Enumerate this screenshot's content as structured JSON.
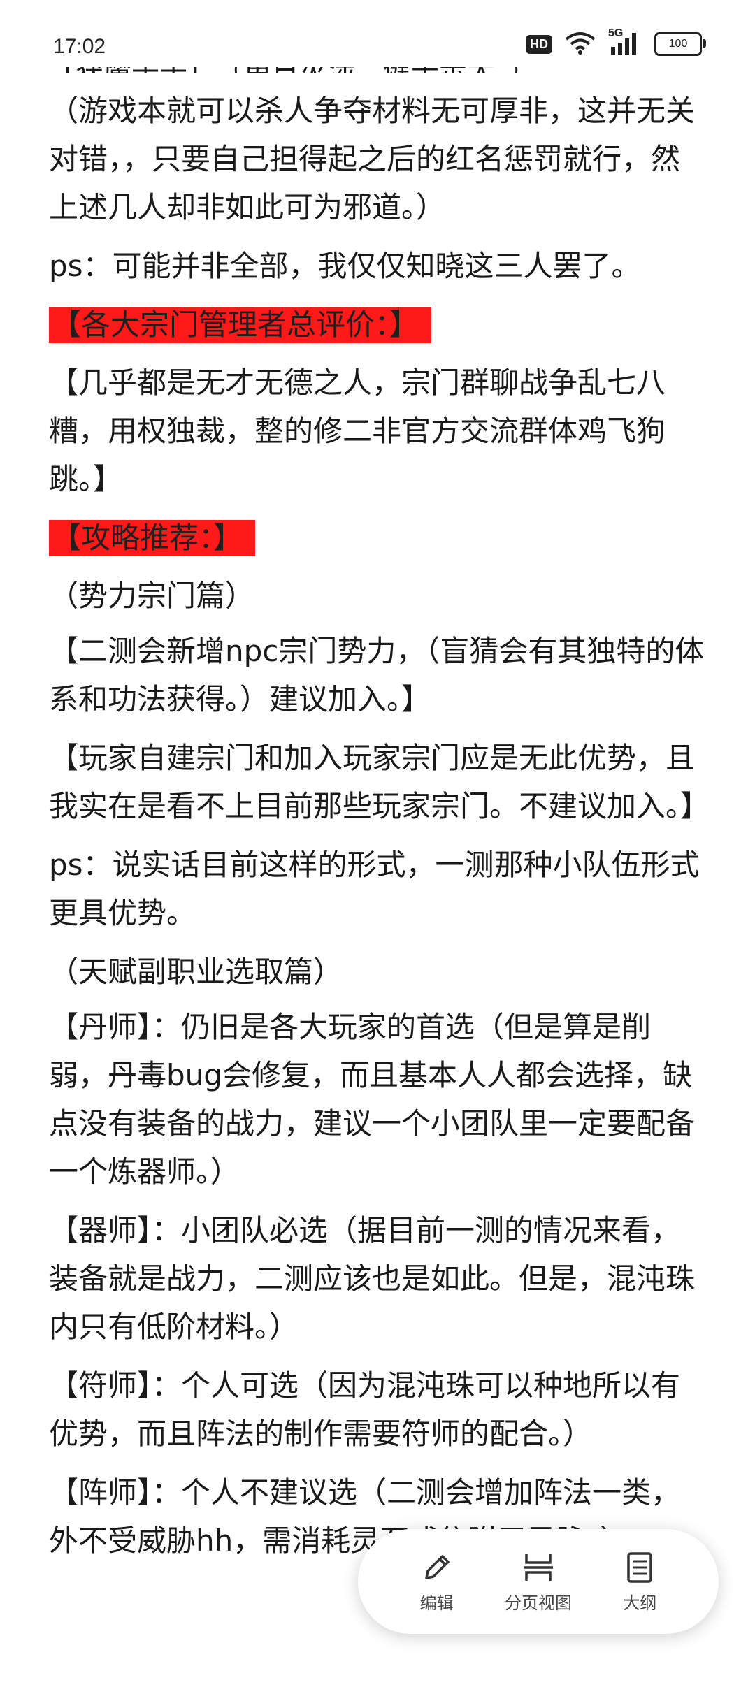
{
  "status_bar": {
    "time": "17:02",
    "hd": "HD",
    "network": "5G",
    "battery": "100"
  },
  "clipped_top_line": "【获魔子子】：（更日灭涉，健于示大。）",
  "paragraphs": [
    "（游戏本就可以杀人争夺材料无可厚非，这并无关对错，，只要自己担得起之后的红名惩罚就行，然上述几人却非如此可为邪道。）",
    "ps：可能并非全部，我仅仅知晓这三人罢了。"
  ],
  "section1": {
    "heading": "【各大宗门管理者总评价：】",
    "body": "【几乎都是无才无德之人，宗门群聊战争乱七八糟，用权独裁，整的修二非官方交流群体鸡飞狗跳。】"
  },
  "section2": {
    "heading": "【攻略推荐：】",
    "sub_forces": "（势力宗门篇）",
    "p1": "【二测会新增npc宗门势力，（盲猜会有其独特的体系和功法获得。）建议加入。】",
    "p2": "【玩家自建宗门和加入玩家宗门应是无此优势，且我实在是看不上目前那些玩家宗门。不建议加入。】",
    "p3": "ps：说实话目前这样的形式，一测那种小队伍形式更具优势。",
    "sub_talent": "（天赋副职业选取篇）",
    "p4": "【丹师】：仍旧是各大玩家的首选（但是算是削弱，丹毒bug会修复，而且基本人人都会选择，缺点没有装备的战力，建议一个小团队里一定要配备一个炼器师。）",
    "p5": "【器师】：小团队必选（据目前一测的情况来看，装备就是战力，二测应该也是如此。但是，混沌珠内只有低阶材料。）",
    "p6": "【符师】：个人可选（因为混沌珠可以种地所以有优势，而且阵法的制作需要符师的配合。）",
    "p7": "【阵师】：个人不建议选（二测会增加阵法一类，外不受威胁hh，需消耗灵石或依附于灵脉。）"
  },
  "toolbar": {
    "edit_label": "编辑",
    "page_view_label": "分页视图",
    "outline_label": "大纲"
  },
  "colors": {
    "highlight": "#ff1a1a",
    "text": "#1a1a1a",
    "background": "#ffffff"
  },
  "icons": [
    "hd-icon",
    "wifi-icon",
    "signal-icon",
    "battery-icon",
    "pencil-icon",
    "page-view-icon",
    "outline-icon"
  ]
}
